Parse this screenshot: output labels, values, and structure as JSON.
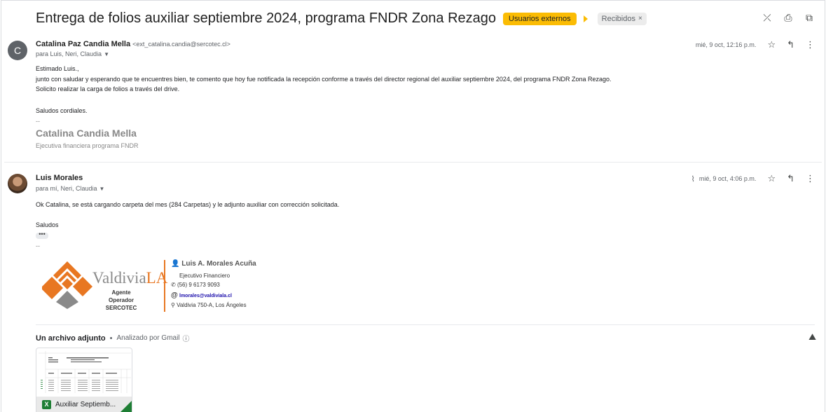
{
  "subject": "Entrega de folios auxiliar septiembre 2024, programa FNDR Zona Rezago",
  "labels": {
    "external": "Usuarios externos",
    "inbox": "Recibidos",
    "inbox_remove": "×"
  },
  "top_icons": {
    "collapse": "⤫",
    "print": "⎙",
    "popout": "⧉"
  },
  "message1": {
    "avatar_letter": "C",
    "sender_name": "Catalina Paz Candia Mella",
    "sender_email": "<ext_catalina.candia@sercotec.cl>",
    "to": "para Luis, Neri, Claudia",
    "date": "mié, 9 oct, 12:16 p.m.",
    "greeting": "Estimado Luis.,",
    "line1": "junto con saludar y esperando que te encuentres bien, te comento que hoy fue notificada la recepción conforme a través del director regional del auxiliar septiembre 2024, del programa FNDR Zona Rezago.",
    "line2": "Solicito realizar la carga de folios a través del drive.",
    "closing": "Saludos cordiales.",
    "sig_sep": "--",
    "sig_name": "Catalina Candia Mella",
    "sig_role": "Ejecutiva financiera programa FNDR"
  },
  "message2": {
    "sender_name": "Luis Morales",
    "to": "para mí, Neri, Claudia",
    "date": "mié, 9 oct, 4:06 p.m.",
    "line1": "Ok Catalina, se está cargando carpeta del mes (284 Carpetas) y le adjunto auxiliar con corrección solicitada.",
    "closing": "Saludos",
    "dots": "•••",
    "sig_sep": "--",
    "signature": {
      "brand": "Valdivia",
      "brand_accent": "LA",
      "sub1": "Agente Operador",
      "sub2": "SERCOTEC",
      "name": "Luis A. Morales Acuña",
      "role": "Ejecutivo Financiero",
      "phone": "(56) 9 6173 9093",
      "email": "lmorales@valdiviala.cl",
      "address": "Valdivia 750-A, Los Ángeles"
    }
  },
  "attachments": {
    "heading": "Un archivo adjunto",
    "separator": "•",
    "scanned": "Analizado por Gmail",
    "file_name": "Auxiliar Septiemb...",
    "file_type_letter": "X"
  },
  "colors": {
    "external_chip": "#fbbc04",
    "brand_orange": "#e87722",
    "excel_green": "#1e7e34"
  }
}
